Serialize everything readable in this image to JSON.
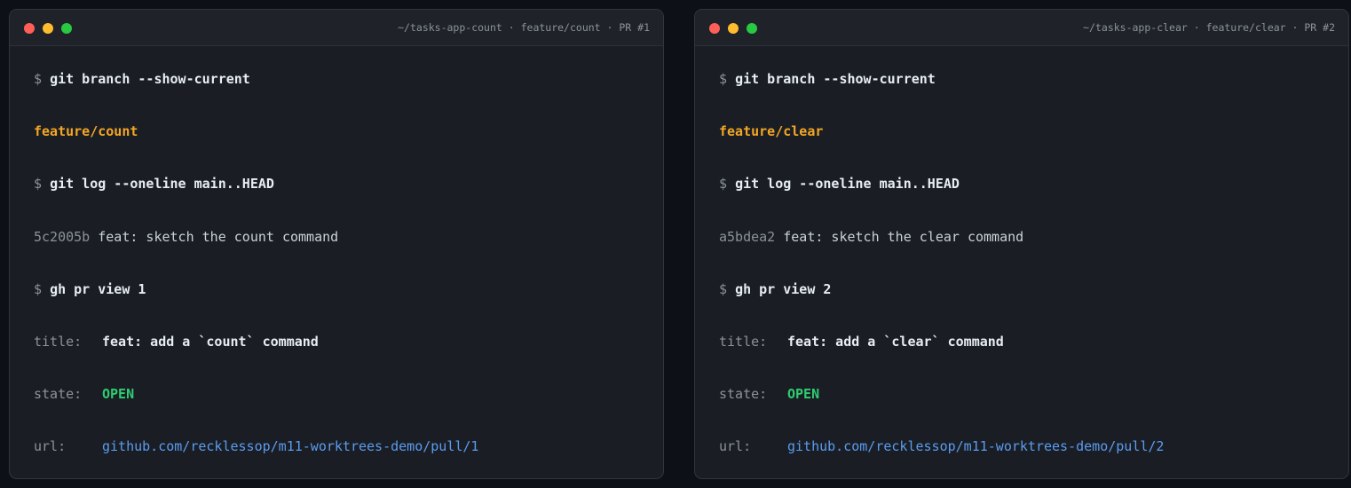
{
  "terminals": [
    {
      "title": "~/tasks-app-count · feature/count · PR #1",
      "prompt": "$",
      "cmd1": "git branch --show-current",
      "branch": "feature/count",
      "cmd2": "git log --oneline main..HEAD",
      "commit_hash": "5c2005b",
      "commit_msg": "feat: sketch the count command",
      "cmd3": "gh pr view 1",
      "title_key": "title:",
      "pr_title": "feat: add a `count` command",
      "state_key": "state:",
      "state": "OPEN",
      "url_key": "url:",
      "url": "github.com/recklessop/m11-worktrees-demo/pull/1"
    },
    {
      "title": "~/tasks-app-clear · feature/clear · PR #2",
      "prompt": "$",
      "cmd1": "git branch --show-current",
      "branch": "feature/clear",
      "cmd2": "git log --oneline main..HEAD",
      "commit_hash": "a5bdea2",
      "commit_msg": "feat: sketch the clear command",
      "cmd3": "gh pr view 2",
      "title_key": "title:",
      "pr_title": "feat: add a `clear` command",
      "state_key": "state:",
      "state": "OPEN",
      "url_key": "url:",
      "url": "github.com/recklessop/m11-worktrees-demo/pull/2"
    }
  ],
  "colors": {
    "background": "#0d1117",
    "terminal_bg": "#1a1e24",
    "branch": "#f5a623",
    "state_open": "#2ecc71",
    "link": "#5b9bf0",
    "dot_red": "#ff5f57",
    "dot_yellow": "#febc2e",
    "dot_green": "#28c840"
  }
}
